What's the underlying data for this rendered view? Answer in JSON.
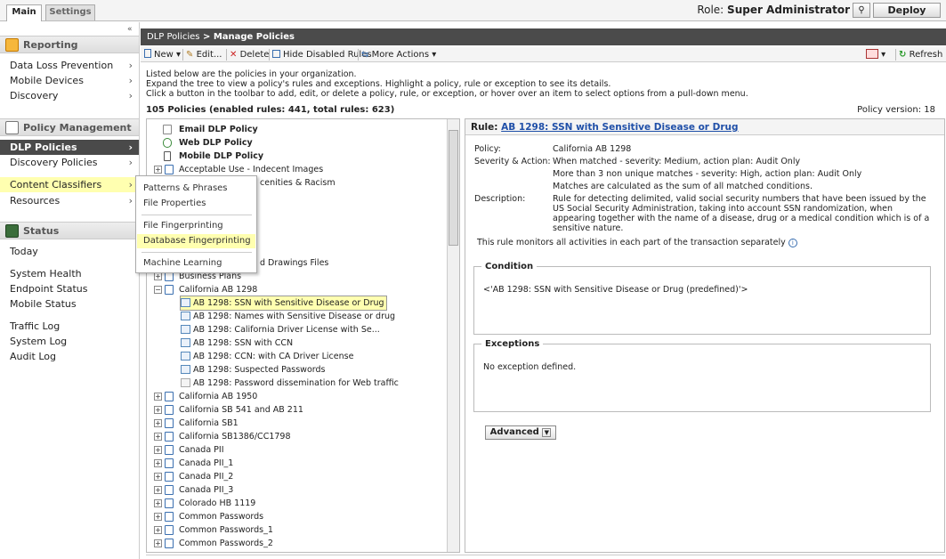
{
  "tabs": {
    "main": "Main",
    "settings": "Settings"
  },
  "role": {
    "label": "Role:",
    "value": "Super Administrator"
  },
  "deploy": "Deploy",
  "collapse": "«",
  "nav": {
    "reporting": {
      "title": "Reporting",
      "items": [
        "Data Loss Prevention",
        "Mobile Devices",
        "Discovery"
      ]
    },
    "policy": {
      "title": "Policy Management",
      "items": [
        "DLP Policies",
        "Discovery Policies",
        "Content Classifiers",
        "Resources"
      ]
    },
    "status": {
      "title": "Status",
      "items": [
        "Today",
        "System Health",
        "Endpoint Status",
        "Mobile Status",
        "Traffic Log",
        "System Log",
        "Audit Log"
      ]
    },
    "chevron": "›"
  },
  "flyout": [
    "Patterns & Phrases",
    "File Properties",
    "File Fingerprinting",
    "Database Fingerprinting",
    "Machine Learning"
  ],
  "breadcrumb": {
    "parent": "DLP Policies",
    "sep": " > ",
    "current": "Manage Policies"
  },
  "toolbar": {
    "new": "New",
    "edit": "Edit...",
    "delete": "Delete",
    "hide": "Hide Disabled Rules",
    "more": "More Actions",
    "refresh": "Refresh"
  },
  "intro": [
    "Listed below are the policies in your organization.",
    "Expand the tree to view a policy's rules and exceptions. Highlight a policy, rule or exception to see its details.",
    "Click a button in the toolbar to add, edit, or delete a policy, rule, or exception, or hover over an item to select options from a pull-down menu."
  ],
  "count": "105 Policies (enabled rules: 441, total rules: 623)",
  "policy_version": "Policy version: 18",
  "tree": {
    "top": [
      "Email DLP Policy",
      "Web DLP Policy",
      "Mobile DLP Policy"
    ],
    "acceptable": "Acceptable Use - Indecent Images",
    "obscured1": "cenities & Racism",
    "obscured2": "d Drawings Files",
    "business": "Business Plans",
    "ca": "California AB 1298",
    "rules": [
      "AB 1298: SSN with Sensitive Disease or Drug",
      "AB 1298: Names with Sensitive Disease or drug",
      "AB 1298: California Driver License with Se...",
      "AB 1298: SSN with CCN",
      "AB 1298: CCN: with CA Driver License",
      "AB 1298: Suspected Passwords",
      "AB 1298: Password dissemination for Web traffic"
    ],
    "policies": [
      "California AB 1950",
      "California SB 541 and AB 211",
      "California SB1",
      "California SB1386/CC1798",
      "Canada PII",
      "Canada PII_1",
      "Canada PII_2",
      "Canada PII_3",
      "Colorado HB 1119",
      "Common Passwords",
      "Common Passwords_1",
      "Common Passwords_2"
    ],
    "plus": "+",
    "minus": "−"
  },
  "rule": {
    "label": "Rule:",
    "name": "AB 1298: SSN with Sensitive Disease or Drug",
    "policy_label": "Policy:",
    "policy": "California AB 1298",
    "sev_label": "Severity & Action:",
    "sev": [
      "When matched - severity: Medium, action plan: Audit Only",
      "More than 3 non unique matches - severity: High, action plan: Audit Only",
      "Matches are calculated as the sum of all matched conditions."
    ],
    "desc_label": "Description:",
    "desc": "Rule for detecting delimited, valid social security numbers that have been issued by the US Social Security Administration, taking into account SSN randomization, when appearing together with the name of a disease, drug or a medical condition which is of a sensitive nature.",
    "monitor": "This rule monitors all activities in each part of the transaction separately",
    "condition_title": "Condition",
    "condition": "<'AB 1298: SSN with Sensitive Disease or Drug (predefined)'>",
    "exceptions_title": "Exceptions",
    "exceptions": "No exception defined.",
    "advanced": "Advanced"
  }
}
